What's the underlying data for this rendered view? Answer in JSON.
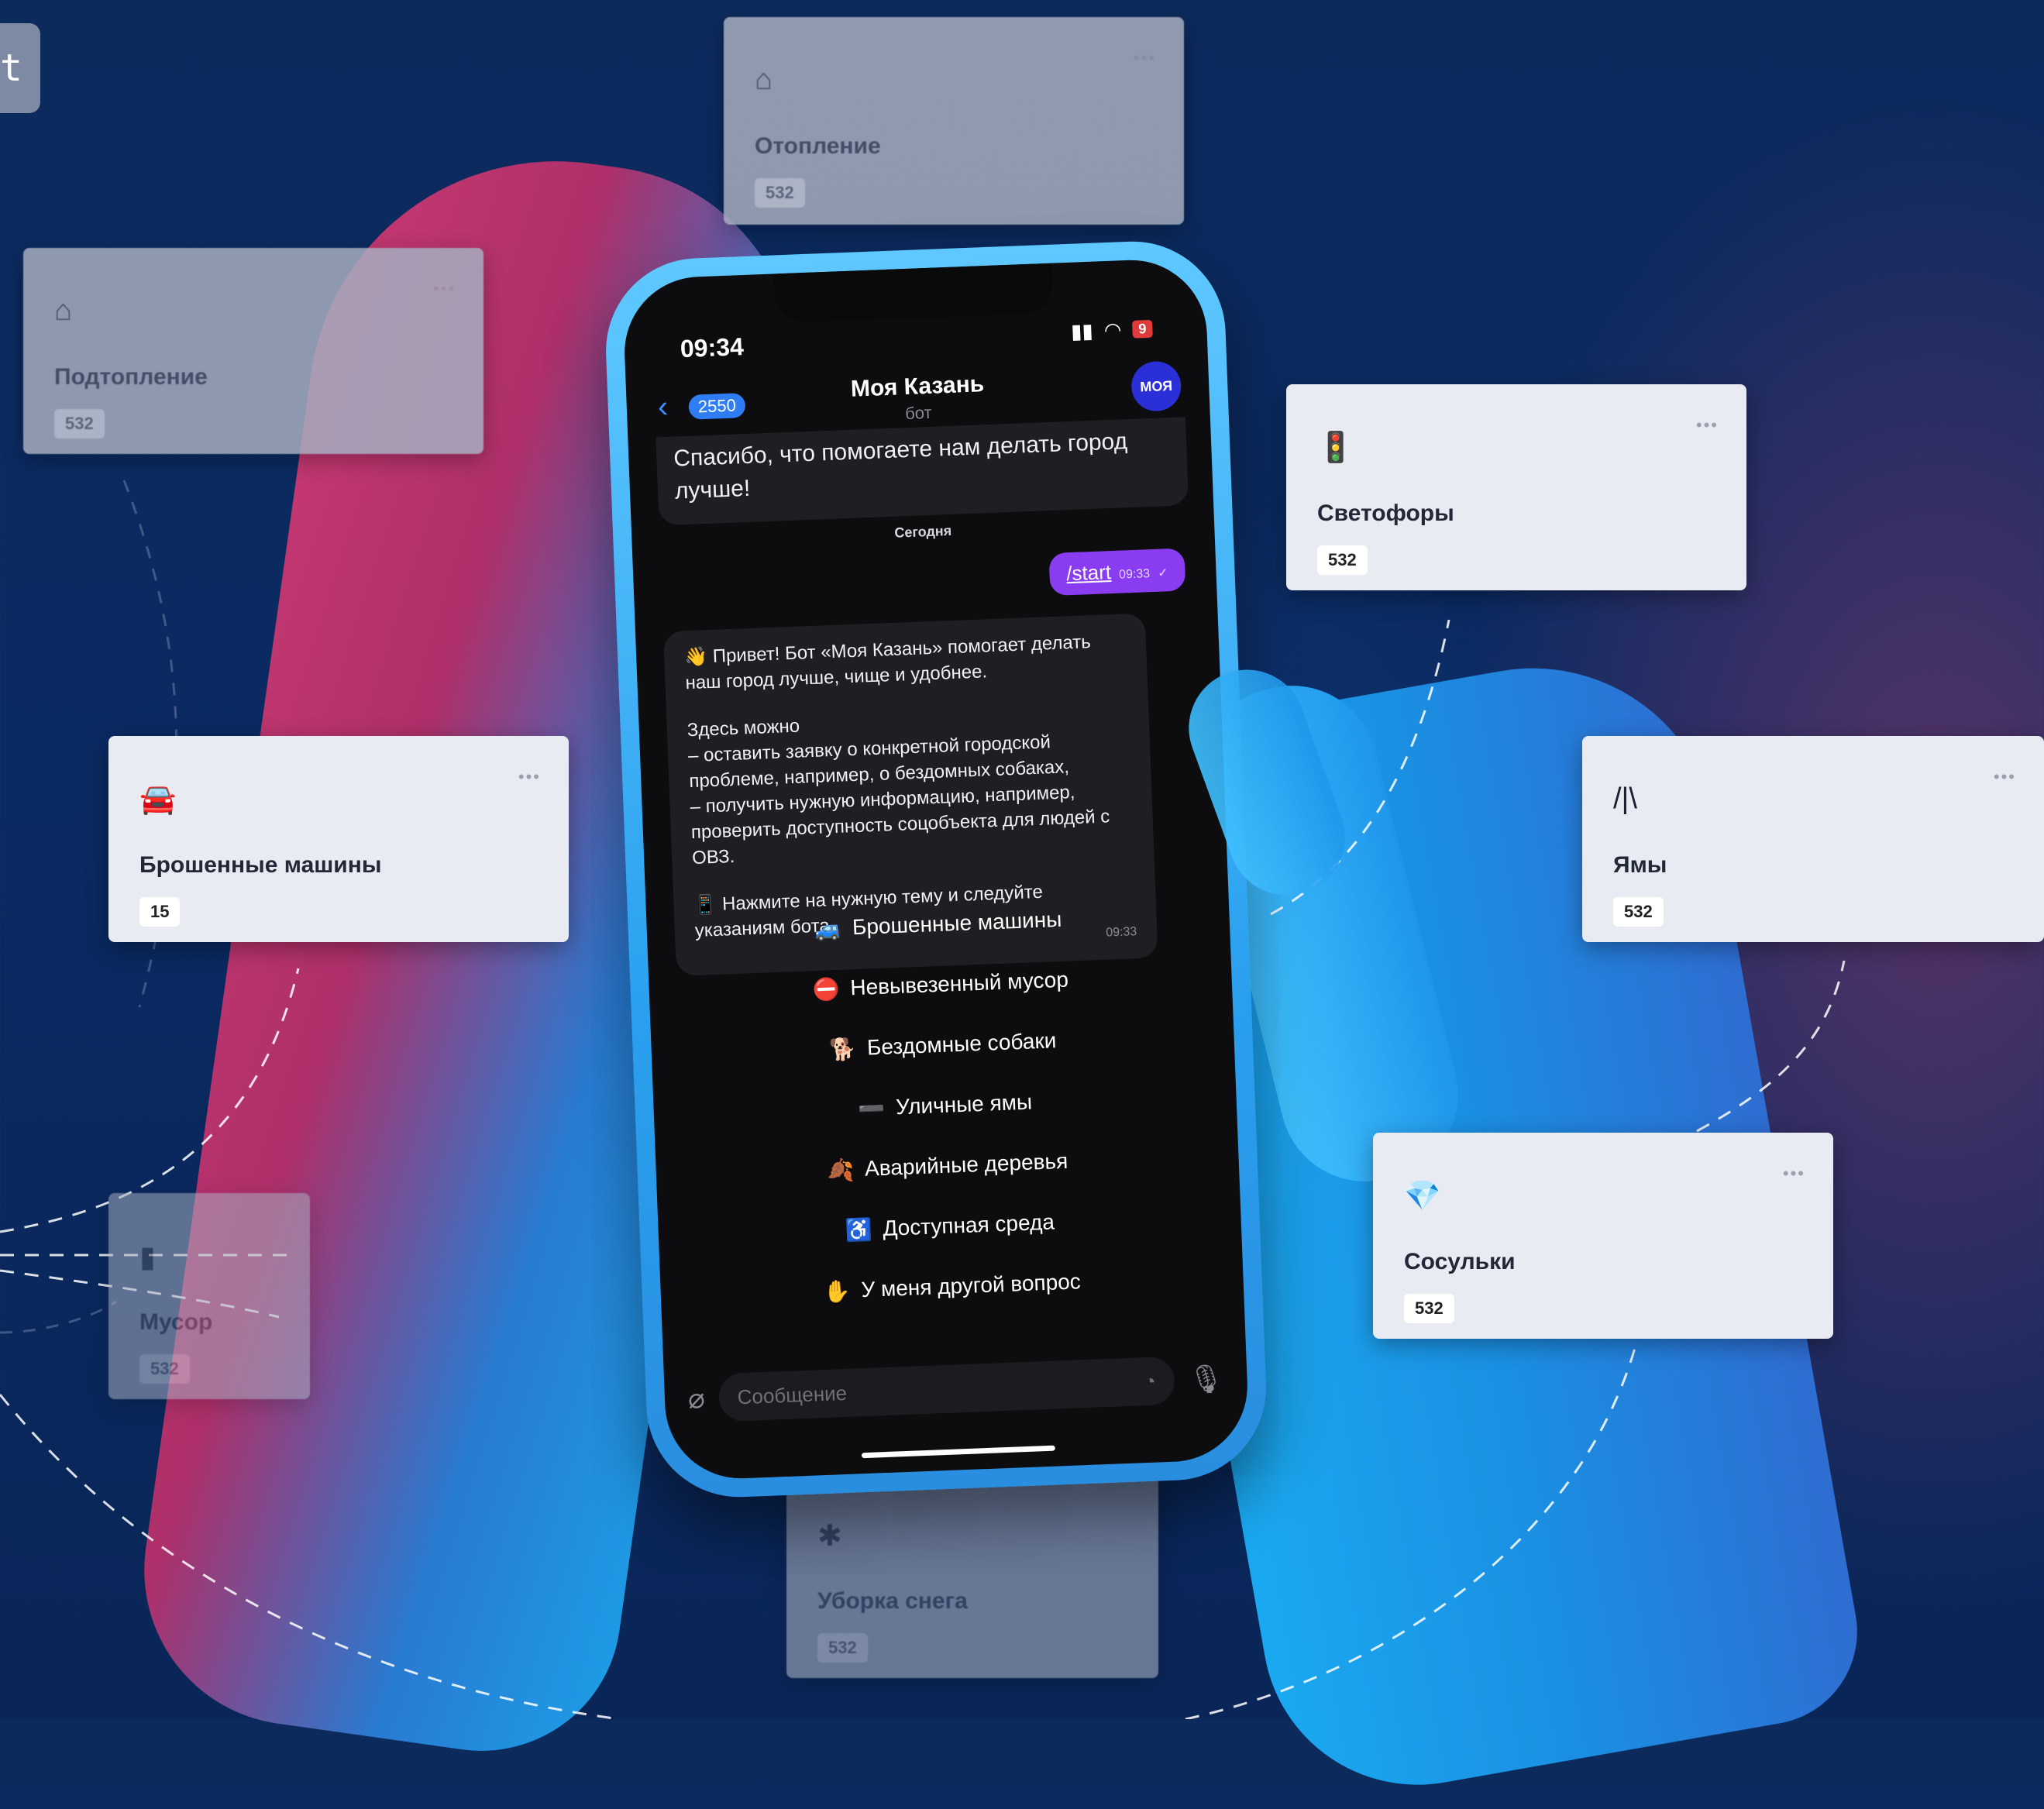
{
  "corner_tab": {
    "text": "t"
  },
  "background_cards": [
    {
      "id": "heating",
      "icon": "house-flame-icon",
      "title": "Отопление",
      "count": "532"
    },
    {
      "id": "flooding",
      "icon": "house-water-icon",
      "title": "Подтопление",
      "count": "532"
    },
    {
      "id": "trash",
      "icon": "trash-icon",
      "title": "Мусор",
      "count": "532"
    },
    {
      "id": "snow",
      "icon": "snow-icon",
      "title": "Уборка снега",
      "count": "532"
    }
  ],
  "cards": [
    {
      "id": "traffic-lights",
      "icon": "🚦",
      "title": "Светофоры",
      "count": "532"
    },
    {
      "id": "abandoned-cars",
      "icon": "🚘",
      "title": "Брошенные машины",
      "count": "15"
    },
    {
      "id": "potholes",
      "icon": "/|\\",
      "title": "Ямы",
      "count": "532"
    },
    {
      "id": "icicles",
      "icon": "💎",
      "title": "Сосульки",
      "count": "532"
    }
  ],
  "phone": {
    "status": {
      "time": "09:34",
      "battery": "9"
    },
    "header": {
      "back_count": "2550",
      "title": "Моя Казань",
      "subtitle": "бот",
      "avatar_text": "МОЯ"
    },
    "previous_message": "Спасибо, что помогаете нам делать город лучше!",
    "day_label": "Сегодня",
    "outgoing": {
      "text": "/start",
      "time": "09:33"
    },
    "welcome": {
      "p1": "👋 Привет! Бот «Моя Казань» помогает делать наш город лучше, чище и удобнее.",
      "p2": "Здесь можно\n– оставить заявку о конкретной городской проблеме, например, о бездомных собаках,\n– получить нужную информацию, например, проверить доступность соцобъекта для людей с ОВЗ.",
      "p3": "📱 Нажмите на нужную тему и следуйте указаниям бота.",
      "time": "09:33"
    },
    "buttons": [
      {
        "emoji": "🚙",
        "label": "Брошенные машины"
      },
      {
        "emoji": "⛔",
        "label": "Невывезенный мусор"
      },
      {
        "emoji": "🐕",
        "label": "Бездомные собаки"
      },
      {
        "emoji": "➖",
        "label": "Уличные ямы"
      },
      {
        "emoji": "🍂",
        "label": "Аварийные деревья"
      },
      {
        "emoji": "♿",
        "label": "Доступная среда"
      },
      {
        "emoji": "✋",
        "label": "У меня другой вопрос"
      }
    ],
    "input": {
      "placeholder": "Сообщение"
    }
  },
  "colors": {
    "background": "#0c2a5c",
    "card": "#e9ebf3",
    "outgoing_bubble": "#8a3df0",
    "phone_case": "#2aa0ef"
  }
}
